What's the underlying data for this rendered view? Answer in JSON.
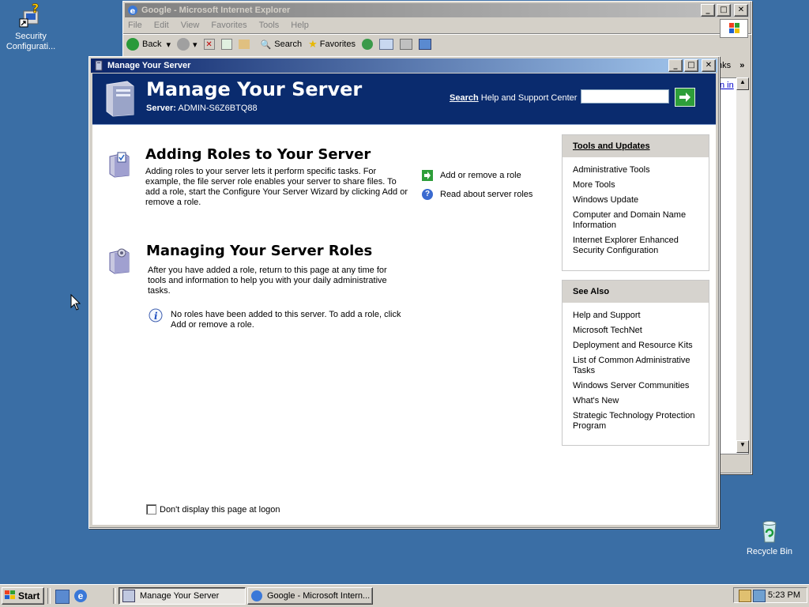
{
  "desktop": {
    "icons": [
      {
        "label": "Security Configurati..."
      },
      {
        "label": "Recycle Bin"
      }
    ]
  },
  "ie_window": {
    "title": "Google - Microsoft Internet Explorer",
    "menu": [
      "File",
      "Edit",
      "View",
      "Favorites",
      "Tools",
      "Help"
    ],
    "toolbar": {
      "back": "Back",
      "search": "Search",
      "favorites": "Favorites"
    },
    "links_fragment": "nks",
    "content_fragment": "n in"
  },
  "mys_window": {
    "title": "Manage Your Server",
    "banner": {
      "heading": "Manage Your Server",
      "server_label": "Server:",
      "server_name": "ADMIN-S6Z6BTQ88",
      "search_bold": "Search",
      "search_rest": "Help and Support Center",
      "search_value": ""
    },
    "adding": {
      "heading": "Adding Roles to Your Server",
      "text": "Adding roles to your server lets it perform specific tasks. For example, the file server role enables your server to share files. To add a role, start the Configure Your Server Wizard by clicking Add or remove a role.",
      "link1": "Add or remove a role",
      "link2": "Read about server roles"
    },
    "managing": {
      "heading": "Managing Your Server Roles",
      "text": "After you have added a role, return to this page at any time for tools and information to help you with your daily administrative tasks.",
      "info": "No roles have been added to this server. To add a role, click Add or remove a role."
    },
    "tools_panel": {
      "title": "Tools and Updates",
      "items": [
        "Administrative Tools",
        "More Tools",
        "Windows Update",
        "Computer and Domain Name Information",
        "Internet Explorer Enhanced Security Configuration"
      ]
    },
    "see_also_panel": {
      "title": "See Also",
      "items": [
        "Help and Support",
        "Microsoft TechNet",
        "Deployment and Resource Kits",
        "List of Common Administrative Tasks",
        "Windows Server Communities",
        "What's New",
        "Strategic Technology Protection Program"
      ]
    },
    "dont_display": "Don't display this page at logon"
  },
  "taskbar": {
    "start": "Start",
    "tasks": [
      "Manage Your Server",
      "Google - Microsoft Intern..."
    ],
    "clock": "5:23 PM"
  },
  "colors": {
    "desktop": "#3a6ea5",
    "banner": "#0a2b6e",
    "title_active": "#0a246a"
  }
}
